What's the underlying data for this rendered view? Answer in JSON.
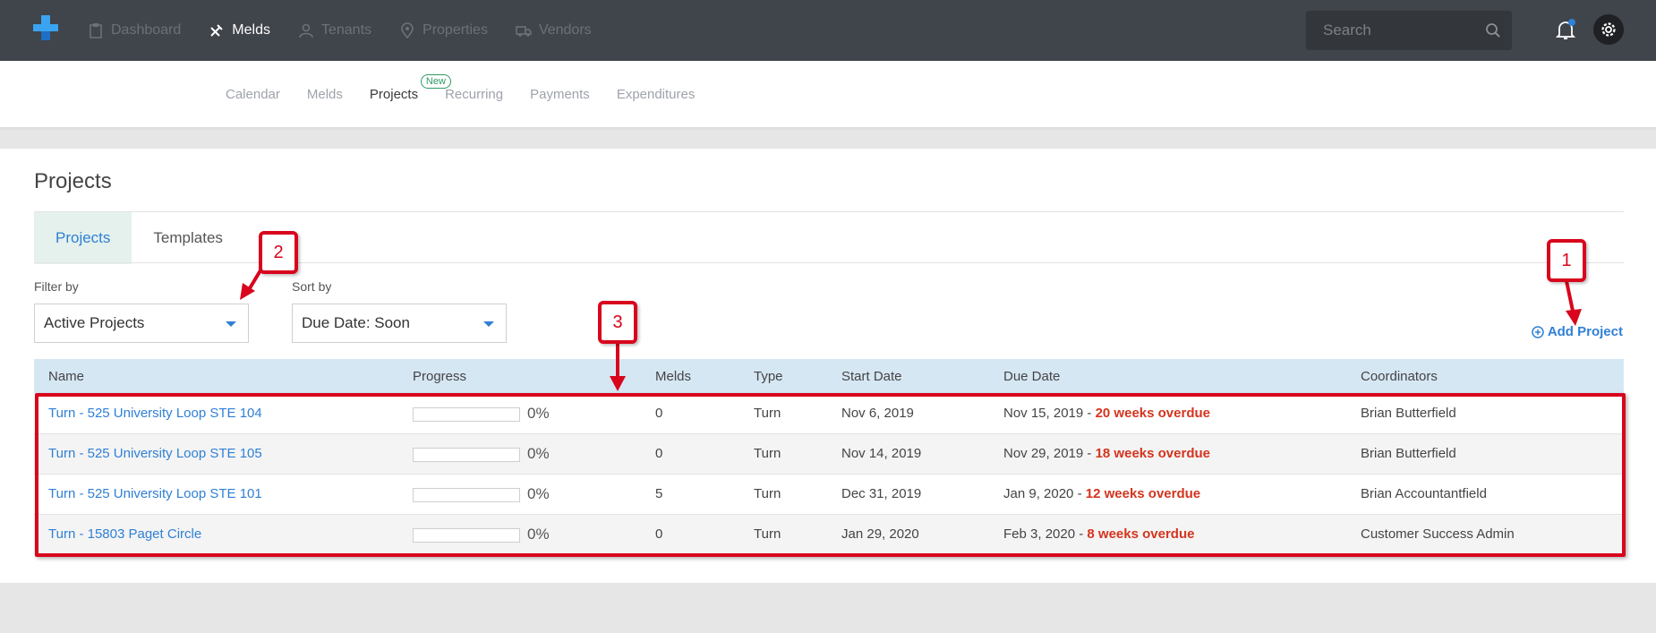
{
  "colors": {
    "accent": "#2f80d6",
    "topbar": "#40444b",
    "overdue": "#d4341e",
    "annotation": "#d8051d",
    "badge": "#2e9a63"
  },
  "topnav": {
    "items": [
      {
        "label": "Dashboard",
        "icon": "clipboard-icon"
      },
      {
        "label": "Melds",
        "icon": "tools-icon",
        "active": true
      },
      {
        "label": "Tenants",
        "icon": "person-icon"
      },
      {
        "label": "Properties",
        "icon": "map-pin-icon"
      },
      {
        "label": "Vendors",
        "icon": "truck-icon"
      }
    ],
    "search_placeholder": "Search"
  },
  "subnav": {
    "items": [
      "Calendar",
      "Melds",
      "Projects",
      "Recurring",
      "Payments",
      "Expenditures"
    ],
    "active": "Projects",
    "new_badge": "New"
  },
  "page": {
    "title": "Projects",
    "tabs": [
      "Projects",
      "Templates"
    ],
    "filter_label": "Filter by",
    "filter_value": "Active Projects",
    "sort_label": "Sort by",
    "sort_value": "Due Date: Soon",
    "add_project_label": "Add Project"
  },
  "table": {
    "columns": [
      "Name",
      "Progress",
      "Melds",
      "Type",
      "Start Date",
      "Due Date",
      "Coordinators"
    ],
    "rows": [
      {
        "name": "Turn - 525 University Loop STE 104",
        "progress": 0,
        "progress_label": "0%",
        "melds": "0",
        "type": "Turn",
        "start": "Nov 6, 2019",
        "due": "Nov 15, 2019 -",
        "overdue": "20 weeks overdue",
        "coordinator": "Brian Butterfield"
      },
      {
        "name": "Turn - 525 University Loop STE 105",
        "progress": 0,
        "progress_label": "0%",
        "melds": "0",
        "type": "Turn",
        "start": "Nov 14, 2019",
        "due": "Nov 29, 2019 -",
        "overdue": "18 weeks overdue",
        "coordinator": "Brian Butterfield"
      },
      {
        "name": "Turn - 525 University Loop STE 101",
        "progress": 0,
        "progress_label": "0%",
        "melds": "5",
        "type": "Turn",
        "start": "Dec 31, 2019",
        "due": "Jan 9, 2020 -",
        "overdue": "12 weeks overdue",
        "coordinator": "Brian Accountantfield"
      },
      {
        "name": "Turn - 15803 Paget Circle",
        "progress": 0,
        "progress_label": "0%",
        "melds": "0",
        "type": "Turn",
        "start": "Jan 29, 2020",
        "due": "Feb 3, 2020 -",
        "overdue": "8 weeks overdue",
        "coordinator": "Customer Success Admin"
      }
    ]
  },
  "annotations": {
    "callout_1": "1",
    "callout_2": "2",
    "callout_3": "3"
  }
}
